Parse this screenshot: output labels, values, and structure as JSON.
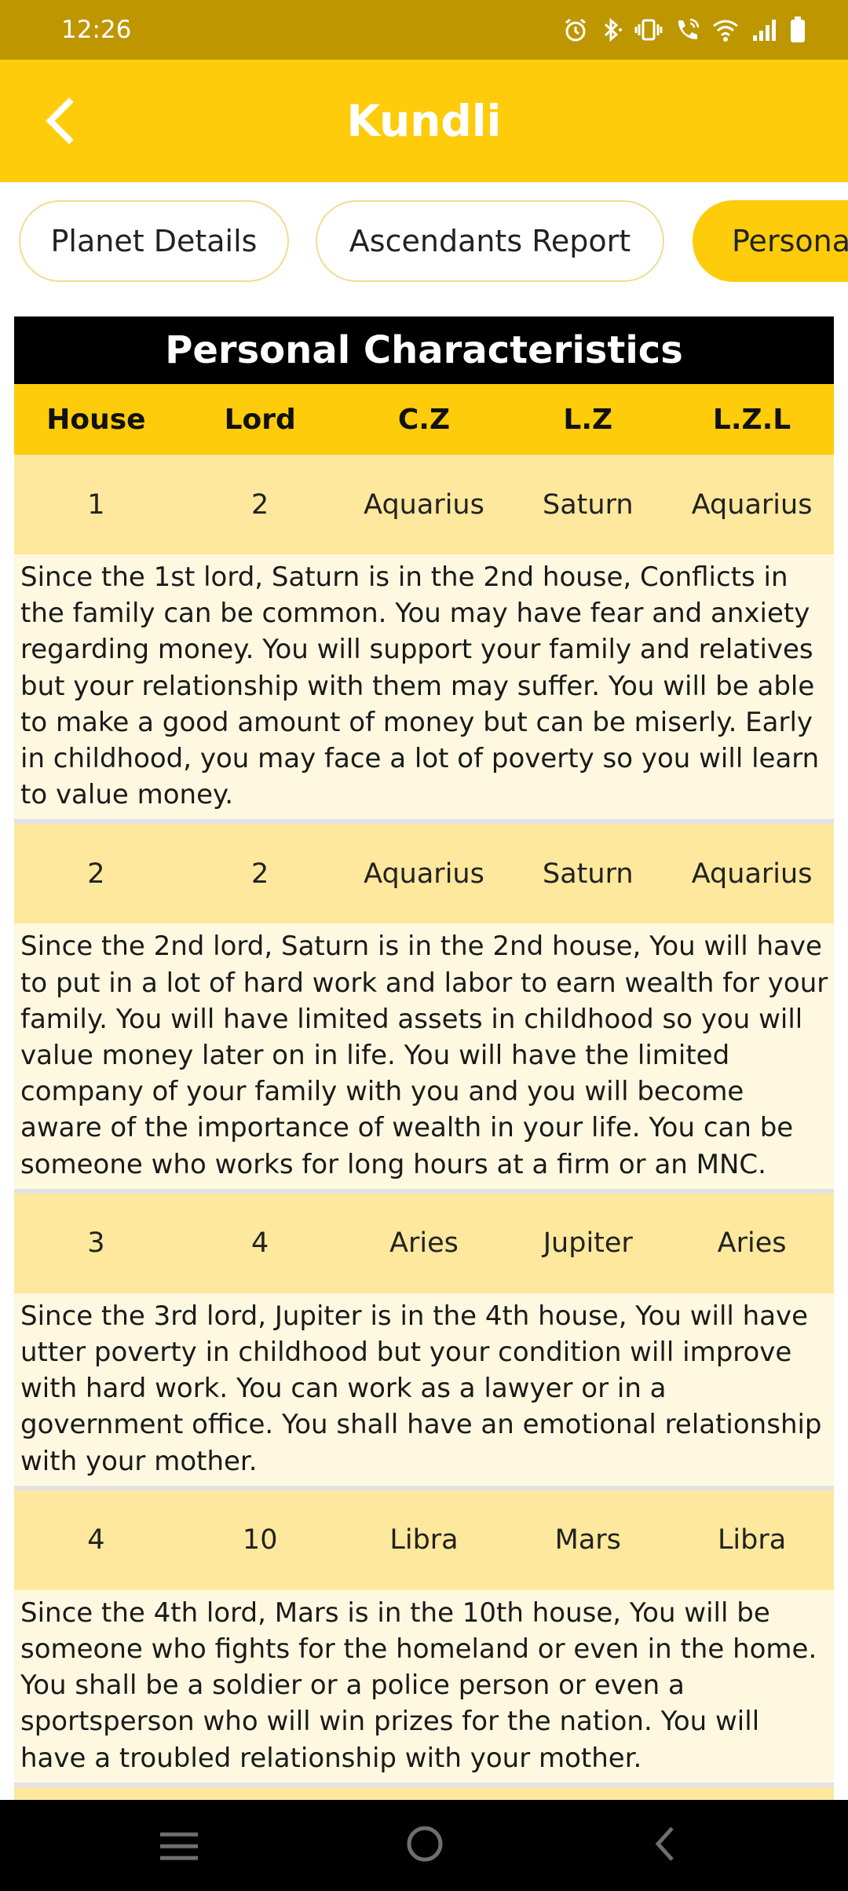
{
  "status_bar": {
    "time": "12:26"
  },
  "app_bar": {
    "title": "Kundli"
  },
  "tabs": [
    {
      "label": "Planet Details",
      "active": false
    },
    {
      "label": "Ascendants Report",
      "active": false
    },
    {
      "label": "Persona",
      "active": true
    }
  ],
  "table": {
    "title": "Personal Characteristics",
    "columns": [
      "House",
      "Lord",
      "C.Z",
      "L.Z",
      "L.Z.L"
    ],
    "rows": [
      {
        "cells": [
          "1",
          "2",
          "Aquarius",
          "Saturn",
          "Aquarius"
        ],
        "description": "Since the  1st lord, Saturn is in the 2nd house, Conflicts in the family can be common. You may have fear and anxiety regarding money. You will support your family and relatives but your relationship with them may suffer. You will be able to make a good amount of money but can be miserly. Early in childhood, you may face a lot of poverty so you will learn to value money."
      },
      {
        "cells": [
          "2",
          "2",
          "Aquarius",
          "Saturn",
          "Aquarius"
        ],
        "description": "Since the  2nd lord, Saturn is in the 2nd house, You will have to put in a lot of hard work and labor to earn wealth for your family. You will have limited assets in childhood so you will value money later on in life. You will have the limited company of your family with you and you will become aware of the importance of wealth in your life. You can be someone who works for long hours at a firm or an MNC."
      },
      {
        "cells": [
          "3",
          "4",
          "Aries",
          "Jupiter",
          "Aries"
        ],
        "description": "Since the  3rd lord, Jupiter is in the 4th house, You will have utter poverty in childhood but your condition will improve with hard work. You can work as a lawyer or in a government office. You shall  have an emotional relationship with your mother."
      },
      {
        "cells": [
          "4",
          "10",
          "Libra",
          "Mars",
          "Libra"
        ],
        "description": "Since the  4th lord, Mars is in the 10th house, You will be someone who fights for the homeland or even in the home. You shall be a soldier or a police person or even a sportsperson who will win prizes for the nation. You will have a troubled relationship with your mother."
      }
    ]
  },
  "colors": {
    "status_bar": "#bd9600",
    "app_bar": "#fecc0a",
    "header_row": "#fecc0a",
    "data_row": "#fde89d",
    "description_row": "#fef8e1",
    "title_bar": "#000000"
  },
  "icons": {
    "status": [
      "alarm-icon",
      "bluetooth-icon",
      "vibrate-icon",
      "wifi-calling-icon",
      "wifi-icon",
      "signal-icon",
      "battery-icon"
    ],
    "app_bar": "back-arrow-icon",
    "nav": [
      "recent-apps-icon",
      "home-icon",
      "back-icon"
    ]
  }
}
